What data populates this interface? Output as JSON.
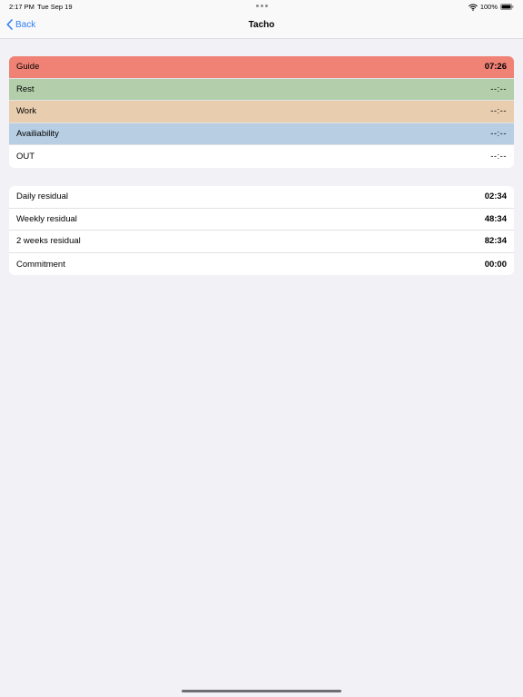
{
  "status_bar": {
    "time": "2:17 PM",
    "date": "Tue Sep 19",
    "battery": "100%"
  },
  "nav": {
    "back_label": "Back",
    "title": "Tacho"
  },
  "status_rows": [
    {
      "label": "Guide",
      "value": "07:26",
      "color": "#ef8275"
    },
    {
      "label": "Rest",
      "value": "--:--",
      "color": "#b3ceab"
    },
    {
      "label": "Work",
      "value": "--:--",
      "color": "#e8cdaf"
    },
    {
      "label": "Availiability",
      "value": "--:--",
      "color": "#b8cee3"
    },
    {
      "label": "OUT",
      "value": "--:--",
      "color": "#ffffff"
    }
  ],
  "residual_rows": [
    {
      "label": "Daily residual",
      "value": "02:34"
    },
    {
      "label": "Weekly residual",
      "value": "48:34"
    },
    {
      "label": "2 weeks residual",
      "value": "82:34"
    },
    {
      "label": "Commitment",
      "value": "00:00"
    }
  ],
  "colors": {
    "accent": "#2f7ff0",
    "background": "#f2f1f6"
  }
}
